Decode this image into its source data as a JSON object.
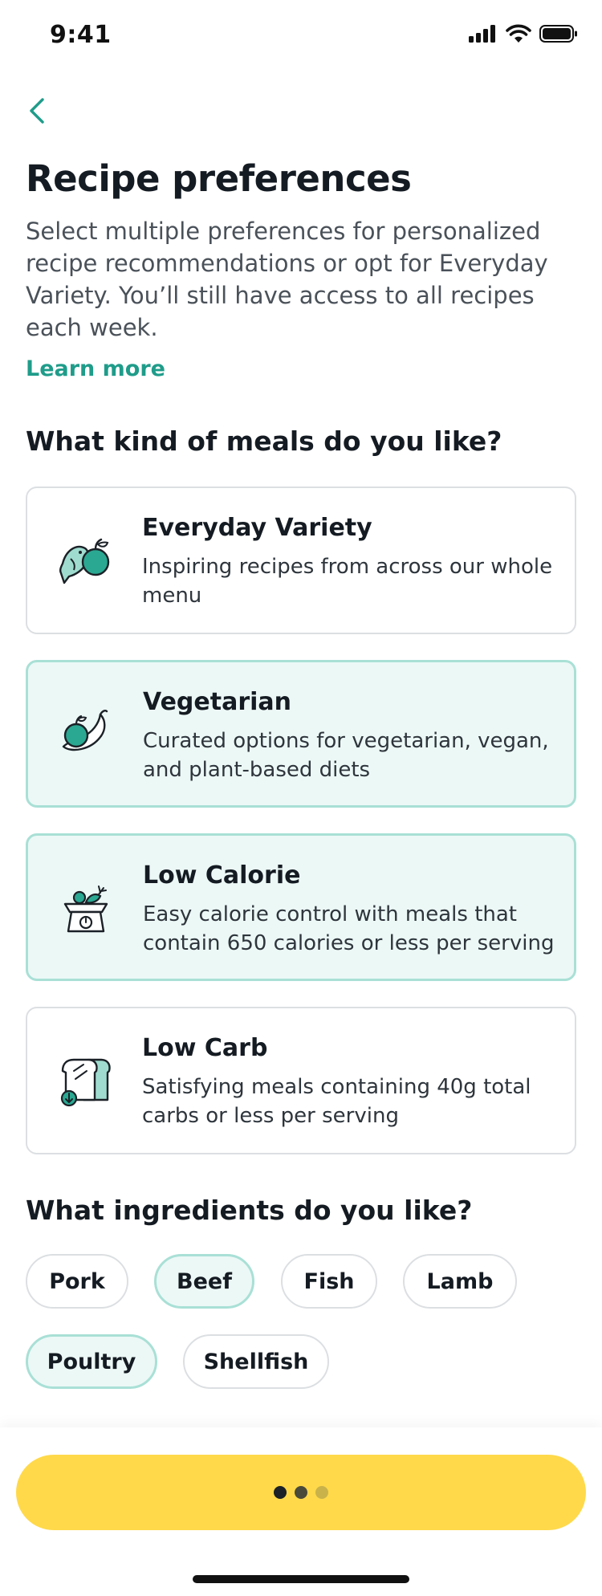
{
  "status": {
    "time": "9:41"
  },
  "header": {
    "title": "Recipe preferences",
    "subtitle": "Select multiple preferences for personalized recipe recommendations or opt for Everyday Variety. You’ll still have access to all recipes each week.",
    "learn_more": "Learn more"
  },
  "meals": {
    "title": "What kind of meals do you like?",
    "items": [
      {
        "title": "Everyday Variety",
        "description": "Inspiring recipes from across our whole menu",
        "selected": false,
        "icon": "fish-apple-icon"
      },
      {
        "title": "Vegetarian",
        "description": "Curated options for vegetarian, vegan, and plant-based diets",
        "selected": true,
        "icon": "eggplant-apple-icon"
      },
      {
        "title": "Low Calorie",
        "description": "Easy calorie control with meals that contain 650 calories or less per serving",
        "selected": true,
        "icon": "kitchen-scale-icon"
      },
      {
        "title": "Low Carb",
        "description": "Satisfying meals containing 40g total carbs or less per serving",
        "selected": false,
        "icon": "bread-down-icon"
      }
    ]
  },
  "ingredients": {
    "title": "What ingredients do you like?",
    "items": [
      {
        "label": "Pork",
        "selected": false
      },
      {
        "label": "Beef",
        "selected": true
      },
      {
        "label": "Fish",
        "selected": false
      },
      {
        "label": "Lamb",
        "selected": false
      },
      {
        "label": "Poultry",
        "selected": true
      },
      {
        "label": "Shellfish",
        "selected": false
      }
    ]
  },
  "colors": {
    "accent": "#1f9c8a",
    "selected_bg": "#ecf8f6",
    "selected_border": "#a9e0d6",
    "cta": "#ffd94a"
  },
  "cta": {
    "state": "loading"
  }
}
